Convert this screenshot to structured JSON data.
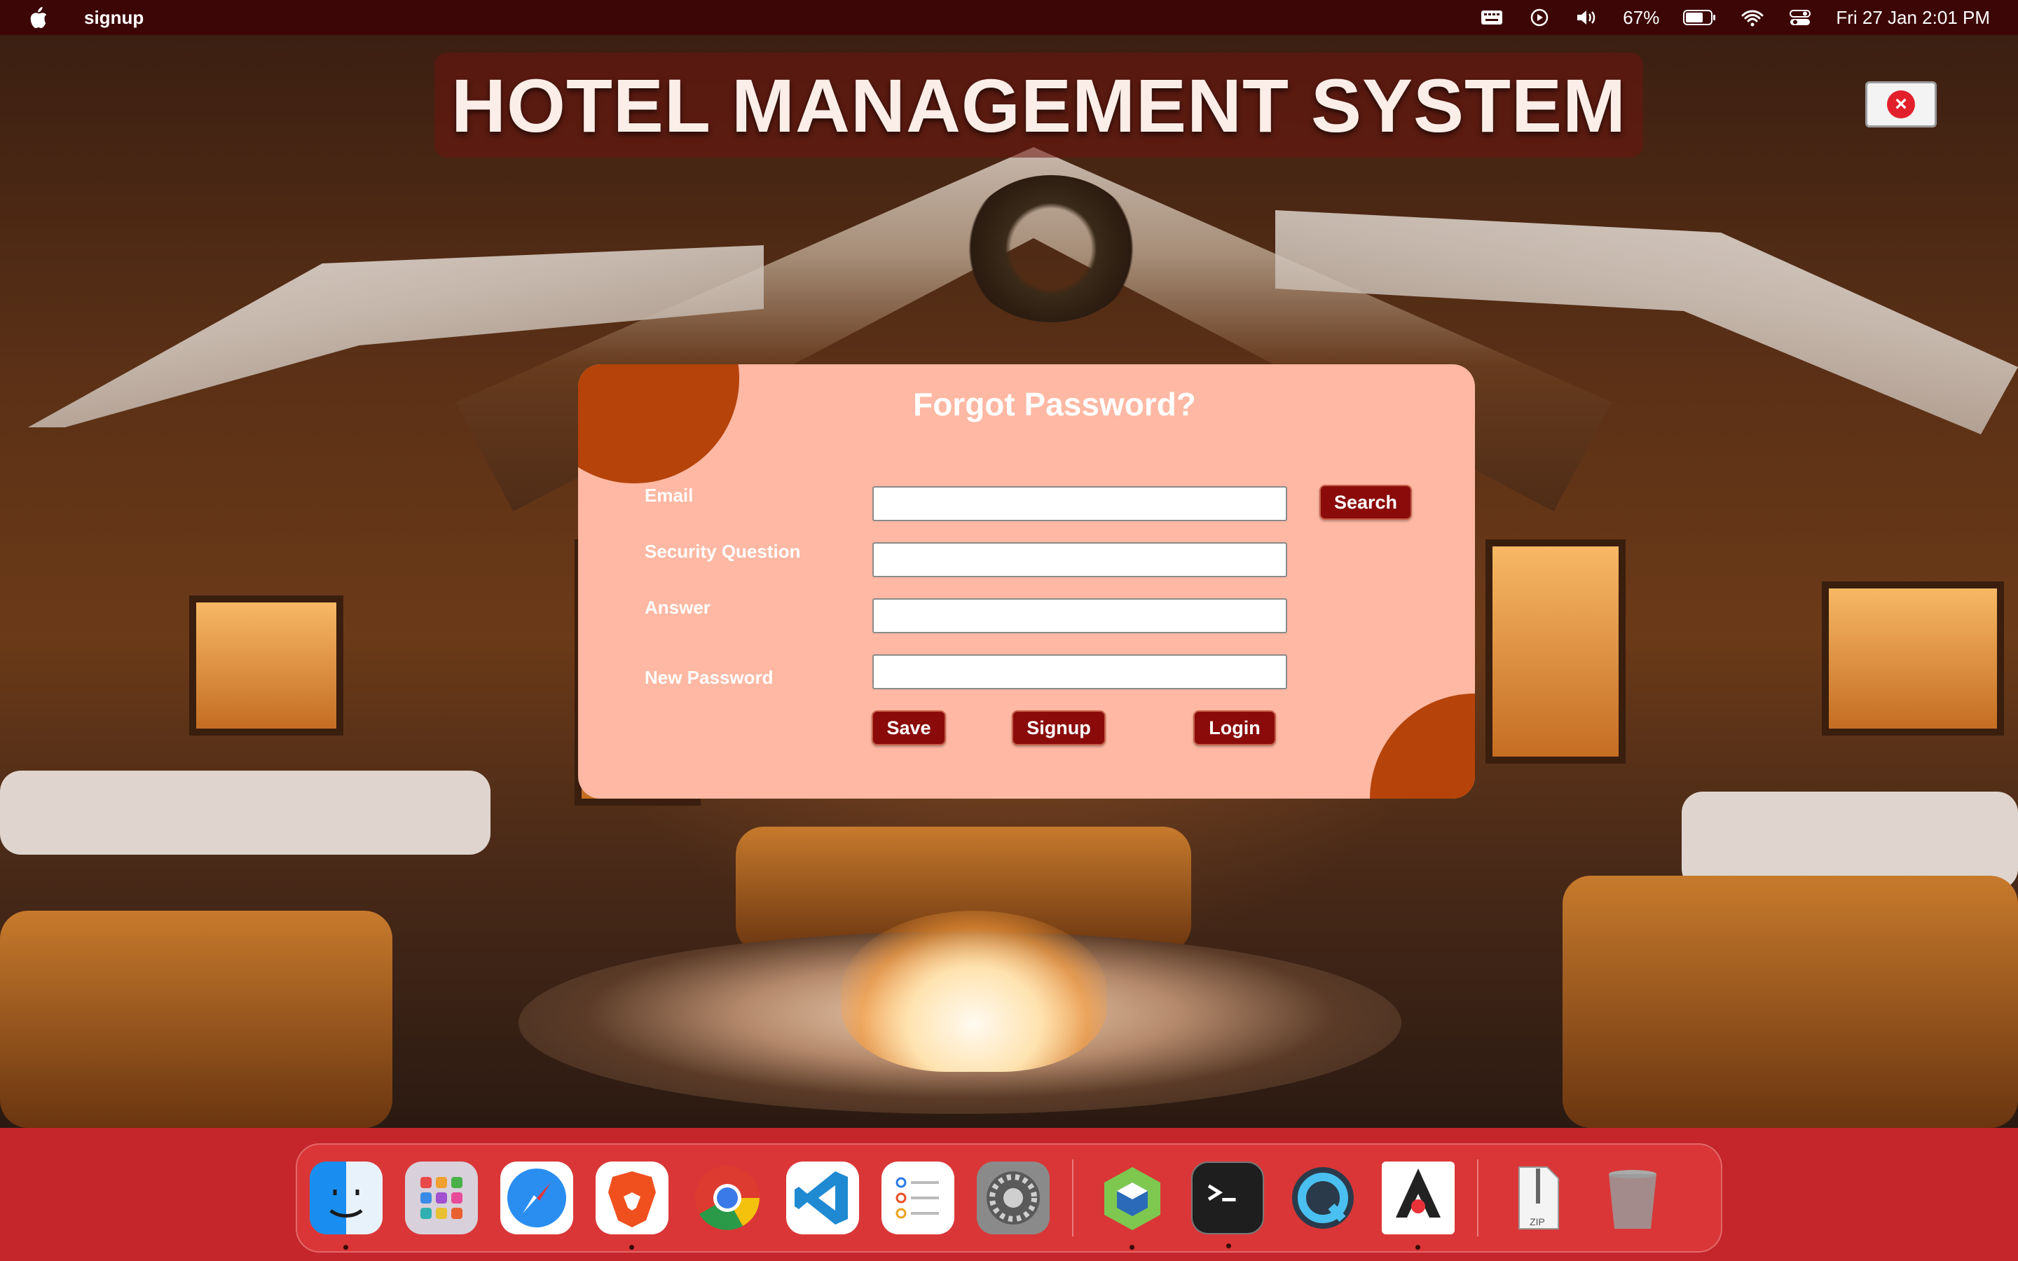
{
  "menubar": {
    "app_name": "signup",
    "battery": "67%",
    "datetime": "Fri 27 Jan  2:01 PM",
    "icons": [
      "apple-icon",
      "keyboard-icon",
      "play-icon",
      "volume-icon",
      "battery-icon",
      "wifi-icon",
      "control-center-icon"
    ]
  },
  "banner": {
    "title": "HOTEL MANAGEMENT SYSTEM"
  },
  "form": {
    "title": "Forgot Password?",
    "labels": {
      "email": "Email",
      "security_question": "Security Question",
      "answer": "Answer",
      "new_password": "New Password"
    },
    "values": {
      "email": "",
      "security_question": "",
      "answer": "",
      "new_password": ""
    },
    "buttons": {
      "search": "Search",
      "save": "Save",
      "signup": "Signup",
      "login": "Login"
    }
  },
  "close_button": {
    "glyph": "×"
  },
  "dock": {
    "apps": [
      {
        "name": "Finder",
        "icon": "finder-icon",
        "running": true
      },
      {
        "name": "Launchpad",
        "icon": "launchpad-icon",
        "running": false
      },
      {
        "name": "Safari",
        "icon": "safari-icon",
        "running": false
      },
      {
        "name": "Brave",
        "icon": "brave-icon",
        "running": true
      },
      {
        "name": "Chrome",
        "icon": "chrome-icon",
        "running": false
      },
      {
        "name": "VS Code",
        "icon": "vscode-icon",
        "running": false
      },
      {
        "name": "Reminders",
        "icon": "reminders-icon",
        "running": false
      },
      {
        "name": "System Settings",
        "icon": "settings-icon",
        "running": false
      },
      {
        "name": "NetBeans",
        "icon": "netbeans-icon",
        "running": true
      },
      {
        "name": "Terminal",
        "icon": "terminal-icon",
        "running": true
      },
      {
        "name": "QuickTime",
        "icon": "quicktime-icon",
        "running": false
      },
      {
        "name": "Java",
        "icon": "java-icon",
        "running": true
      },
      {
        "name": "Archive",
        "icon": "zip-icon",
        "label": "ZIP",
        "running": false
      },
      {
        "name": "Trash",
        "icon": "trash-icon",
        "running": false
      }
    ]
  },
  "colors": {
    "menubar": "#3d0606",
    "panel": "#feb8a3",
    "accent_blob": "#b5430a",
    "button": "#8b0b0b",
    "dock": "#c4262b"
  }
}
